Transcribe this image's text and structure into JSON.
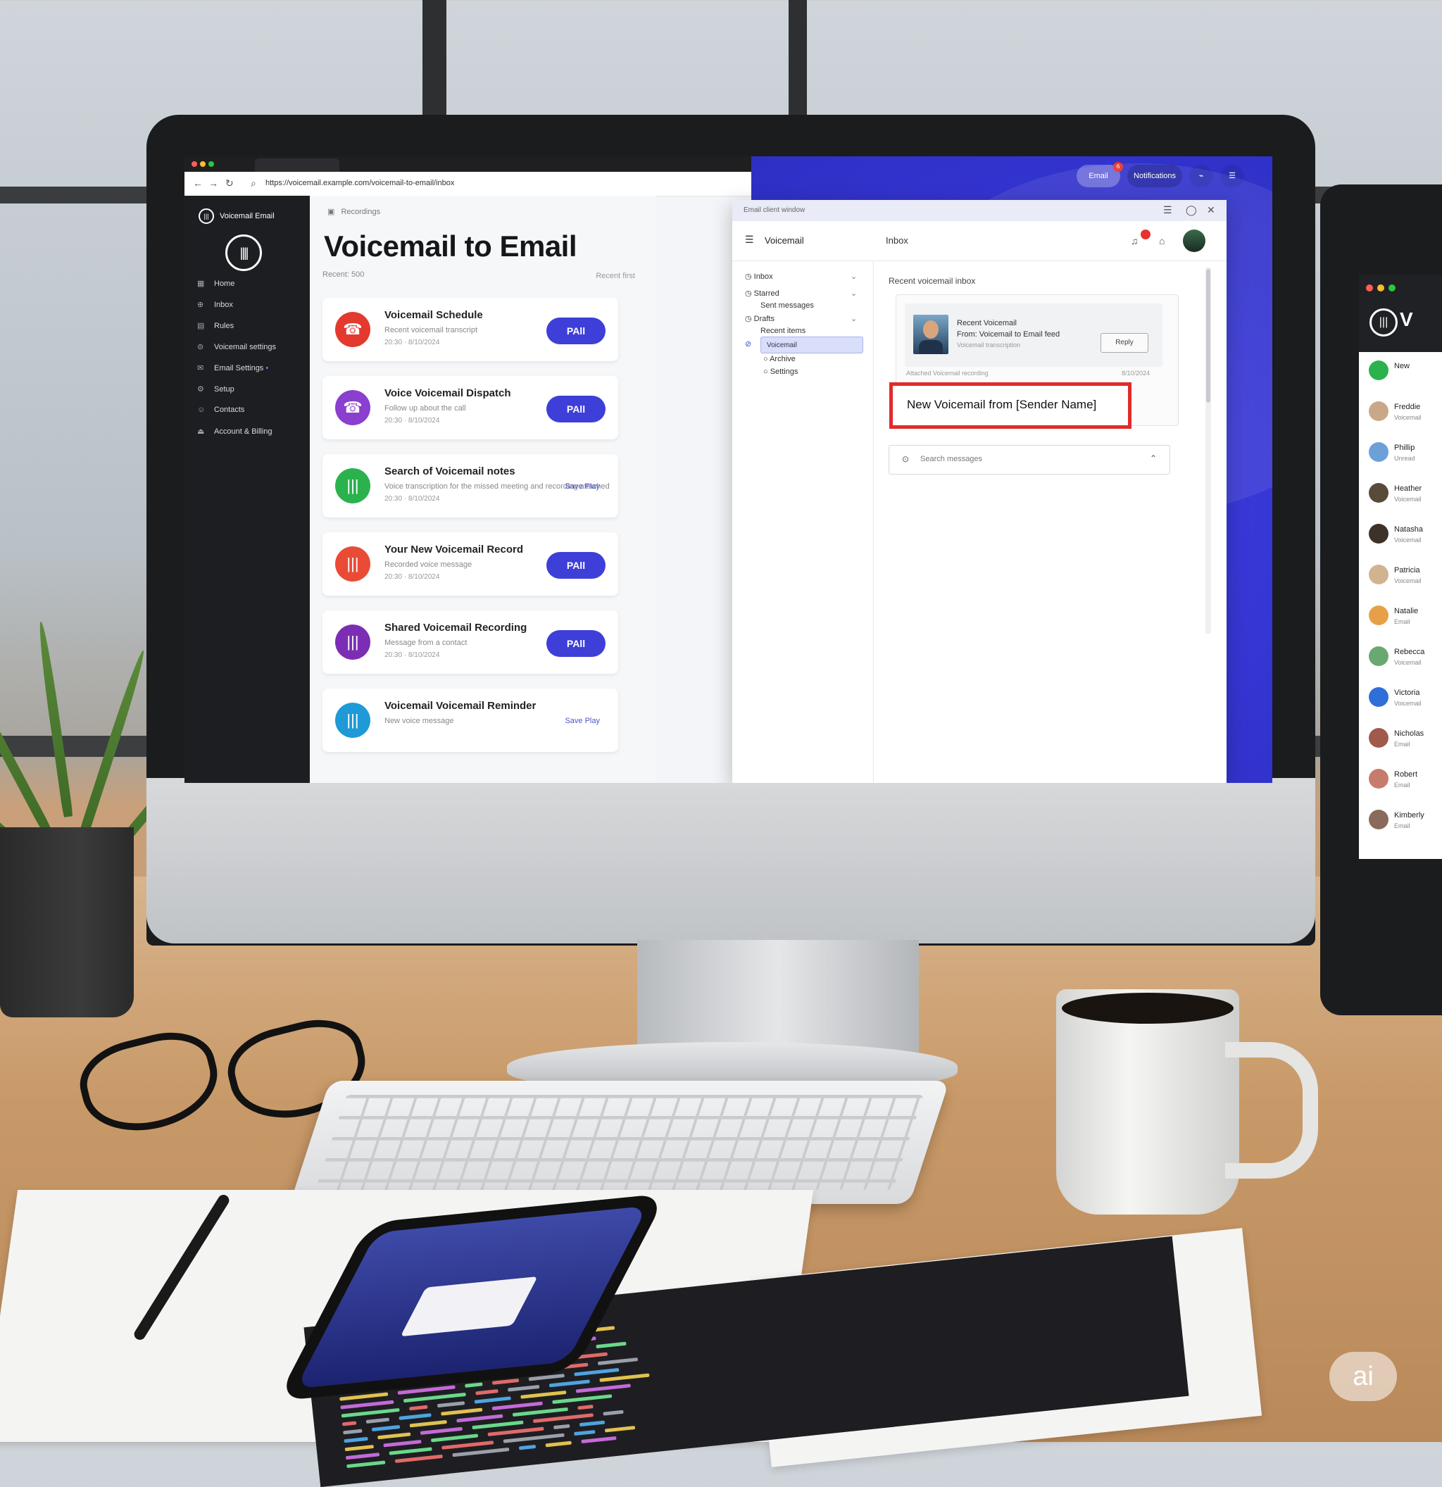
{
  "browser": {
    "url": "https://voicemail.example.com/voicemail-to-email/inbox",
    "tab_label": ""
  },
  "sidebar": {
    "brand": "Voicemail Email",
    "items": [
      {
        "label": "Home",
        "icon": "grid-icon"
      },
      {
        "label": "Inbox",
        "icon": "inbox-icon"
      },
      {
        "label": "Rules",
        "icon": "rules-icon"
      },
      {
        "label": "Voicemail settings",
        "icon": "voicemail-icon"
      },
      {
        "label": "Email Settings",
        "icon": "mail-icon",
        "accent": "on"
      },
      {
        "label": "Setup",
        "icon": "setup-icon"
      },
      {
        "label": "Contacts",
        "icon": "contacts-icon"
      },
      {
        "label": "Account & Billing",
        "icon": "account-icon"
      }
    ]
  },
  "main": {
    "breadcrumb": "Recordings",
    "title": "Voicemail to Email",
    "subtitle": "Recent: 500",
    "sort_label": "Recent first",
    "voicemails": [
      {
        "title": "Voicemail Schedule",
        "desc": "Recent voicemail transcript",
        "time": "20:30 · 8/10/2024",
        "action": "PAll",
        "color": "#e4392e",
        "icon": "phone-icon"
      },
      {
        "title": "Voice Voicemail Dispatch",
        "desc": "Follow up about the call",
        "time": "20:30 · 8/10/2024",
        "action": "PAll",
        "color": "#8a3fcf",
        "icon": "phone-icon"
      },
      {
        "title": "Search of Voicemail notes",
        "desc": "Voice transcription for the missed meeting and recording attached",
        "time": "20:30 · 8/10/2024",
        "action": "Save Play",
        "color": "#2bb24c",
        "icon": "wave-icon"
      },
      {
        "title": "Your New Voicemail Record",
        "desc": "Recorded voice message",
        "time": "20:30 · 8/10/2024",
        "action": "PAll",
        "color": "#ea4b36",
        "icon": "wave-icon"
      },
      {
        "title": "Shared Voicemail Recording",
        "desc": "Message from a contact",
        "time": "20:30 · 8/10/2024",
        "action": "PAll",
        "color": "#7b2eb3",
        "icon": "wave-icon"
      },
      {
        "title": "Voicemail Voicemail Reminder",
        "desc": "New voice message",
        "time": "",
        "action": "Save Play",
        "color": "#1e9ad6",
        "icon": "wave-icon"
      }
    ]
  },
  "topbar": {
    "email_label": "Email",
    "email_badge": "6",
    "second_label": "Notifications"
  },
  "email_window": {
    "title": "Email client window",
    "header_left": "Voicemail",
    "header_right": "Inbox",
    "nav": [
      {
        "label": "Inbox"
      },
      {
        "label": "Starred"
      },
      {
        "label": "Sent messages"
      },
      {
        "label": "Drafts"
      },
      {
        "label": "Recent items"
      },
      {
        "label": "Voicemail",
        "selected": true
      },
      {
        "label": "Archive"
      },
      {
        "label": "Settings"
      }
    ],
    "section_title": "Recent voicemail inbox",
    "message": {
      "line1": "Recent Voicemail",
      "line2": "From: Voicemail to Email feed",
      "line3": "Voicemail transcription",
      "button": "Reply",
      "meta_left": "Attached Voicemail recording",
      "meta_right": "8/10/2024"
    },
    "subject": "New Voicemail from [Sender Name]",
    "search_placeholder": "Search messages"
  },
  "second_monitor": {
    "brand_initial": "V",
    "rows": [
      {
        "name": "New",
        "sub": "",
        "color": "#2bb24c"
      },
      {
        "name": "Freddie",
        "sub": "Voicemail",
        "color": "#c9a88a"
      },
      {
        "name": "Phillip",
        "sub": "Unread",
        "color": "#6ca0d8"
      },
      {
        "name": "Heather",
        "sub": "Voicemail",
        "color": "#5a4a3a"
      },
      {
        "name": "Natasha",
        "sub": "Voicemail",
        "color": "#3d3128"
      },
      {
        "name": "Patricia",
        "sub": "Voicemail",
        "color": "#d2b38f"
      },
      {
        "name": "Natalie",
        "sub": "Email",
        "color": "#e8a048"
      },
      {
        "name": "Rebecca",
        "sub": "Voicemail",
        "color": "#6aa872"
      },
      {
        "name": "Victoria",
        "sub": "Voicemail",
        "color": "#2f6fd8"
      },
      {
        "name": "Nicholas",
        "sub": "Email",
        "color": "#a05a4a"
      },
      {
        "name": "Robert",
        "sub": "Email",
        "color": "#c77b6a"
      },
      {
        "name": "Kimberly",
        "sub": "Email",
        "color": "#8a6a5a"
      }
    ]
  },
  "watermark": "ai",
  "colors": {
    "accent": "#3d3fd8",
    "brand_blue": "#3838d8",
    "highlight_red": "#e12a2a"
  }
}
